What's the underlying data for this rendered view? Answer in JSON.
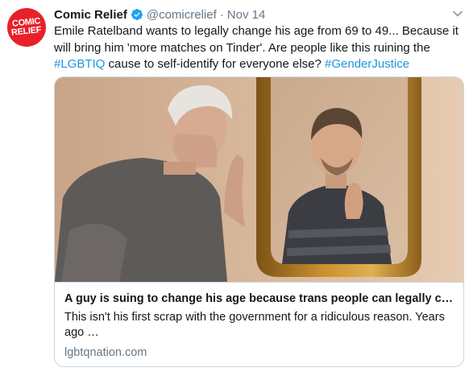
{
  "tweet": {
    "avatar_text_line1": "COMIC",
    "avatar_text_line2": "RELIEF",
    "display_name": "Comic Relief",
    "handle": "@comicrelief",
    "separator": "·",
    "time": "Nov 14",
    "text_part1": "Emile Ratelband wants to legally change his age from 69 to 49... Because it will bring him 'more matches on Tinder'. Are people like this ruining the ",
    "hashtag1": "#LGBTIQ",
    "text_part2": " cause to self-identify for everyone else? ",
    "hashtag2": "#GenderJustice"
  },
  "card": {
    "title": "A guy is suing to change his age because trans people can legally ch...",
    "description": "This isn't his first scrap with the government for a ridiculous reason. Years ago …",
    "domain": "lgbtqnation.com"
  },
  "colors": {
    "brand_red": "#e8202a",
    "link_blue": "#1b95e0",
    "muted_gray": "#657786",
    "border": "#ccd6dd"
  },
  "icons": {
    "verified": "verified-badge-icon",
    "caret": "chevron-down-icon"
  }
}
